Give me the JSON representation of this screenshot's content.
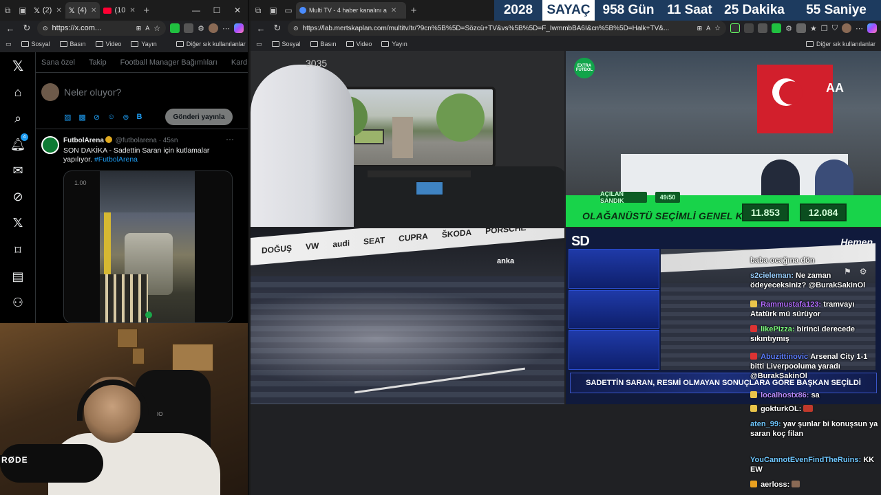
{
  "left_browser": {
    "tabs": [
      {
        "label": "(2)",
        "icon": "x-logo-icon"
      },
      {
        "label": "(4)",
        "icon": "x-logo-icon",
        "active": true
      },
      {
        "label": "(10",
        "icon": "youtube-icon"
      }
    ],
    "url": "https://x.com...",
    "bookmarks": [
      "Sosyal",
      "Basın",
      "Video",
      "Yayın"
    ],
    "other_bookmarks": "Diğer sık kullanılanlar"
  },
  "x_app": {
    "notification_count": "4",
    "tabs": [
      "Sana özel",
      "Takip",
      "Football Manager Bağımlıları",
      "Kard"
    ],
    "compose_placeholder": "Neler oluyor?",
    "post_button": "Gönderi yayınla",
    "tweet": {
      "author": "FutbolArena",
      "handle": "@futbolarena",
      "time": "· 45sn",
      "text": "SON DAKİKA - Sadettin Saran için kutlamalar yapılıyor.",
      "hashtag": "#FutbolArena",
      "video_time": "1.00"
    }
  },
  "webcam": {
    "mic_brand": "RØDE",
    "chair_brand": "IO"
  },
  "right_browser": {
    "tab_title": "Multi TV - 4 haber kanalını a",
    "url": "https://lab.mertskaplan.com/multitv/tr/?9cn%5B%5D=Sözcü+TV&vs%5B%5D=F_IwmmbBA6I&cn%5B%5D=Halk+TV&...",
    "bookmarks": [
      "Sosyal",
      "Basın",
      "Video",
      "Yayın"
    ],
    "other_bookmarks": "Diğer sık kullanılanlar"
  },
  "countdown": {
    "year": "2028",
    "label": "SAYAÇ",
    "days": "958 Gün",
    "hours": "11 Saat",
    "minutes": "25 Dakika",
    "seconds": "55 Saniye"
  },
  "feeds": {
    "tram_number": "3035",
    "election": {
      "logo": "EXTRA FUTBOL",
      "tag_left": "AÇILAN SANDIK",
      "tag_count": "49/50",
      "title": "OLAĞANÜSTÜ SEÇİMLİ GENEL KURUL",
      "score_left": "11.853",
      "score_right": "12.084",
      "agency_logo": "AA"
    },
    "stadium": {
      "ads": [
        "DOĞUŞ",
        "VW",
        "audi",
        "SEAT",
        "CUPRA",
        "ŠKODA",
        "PORSCHE"
      ],
      "watermark": "anka"
    },
    "show": {
      "channel_logo": "SD",
      "sponsor": "Hemen",
      "ticker": "SADETTİN SARAN, RESMİ OLMAYAN SONUÇLARA GÖRE BAŞKAN SEÇİLDİ"
    }
  },
  "chat": [
    {
      "user": "",
      "text": "baba ocağına dön",
      "color": "#ffffff"
    },
    {
      "user": "s2cieleman:",
      "text": "Ne zaman ödeyeceksiniz? @BurakSakinOl",
      "color": "#9ad0ff"
    },
    {
      "user": "Rammustafa123:",
      "text": "tramvayı Atatürk mü sürüyor",
      "color": "#b36cff"
    },
    {
      "user": "likePizza:",
      "text": "birinci derecede sıkıntıymış",
      "color": "#7dff7d"
    },
    {
      "user": "Abuzittinovic",
      "text": "Arsenal City 1-1 bitti Liverpooluma yaradı @BurakSakinOl",
      "color": "#5c7dff"
    },
    {
      "user": "localhostx86:",
      "text": "sa",
      "color": "#b98cff"
    },
    {
      "user": "gokturkOL:",
      "text": "",
      "color": "#ffffff"
    },
    {
      "user": "aten_99:",
      "text": "yav şunlar bi konuşsun ya saran koç filan",
      "color": "#6fc7ff"
    },
    {
      "user": "YouCannotEvenFindTheRuins:",
      "text": "KK EW",
      "color": "#6fc7ff"
    },
    {
      "user": "aerloss:",
      "text": "",
      "color": "#ffffff"
    }
  ]
}
